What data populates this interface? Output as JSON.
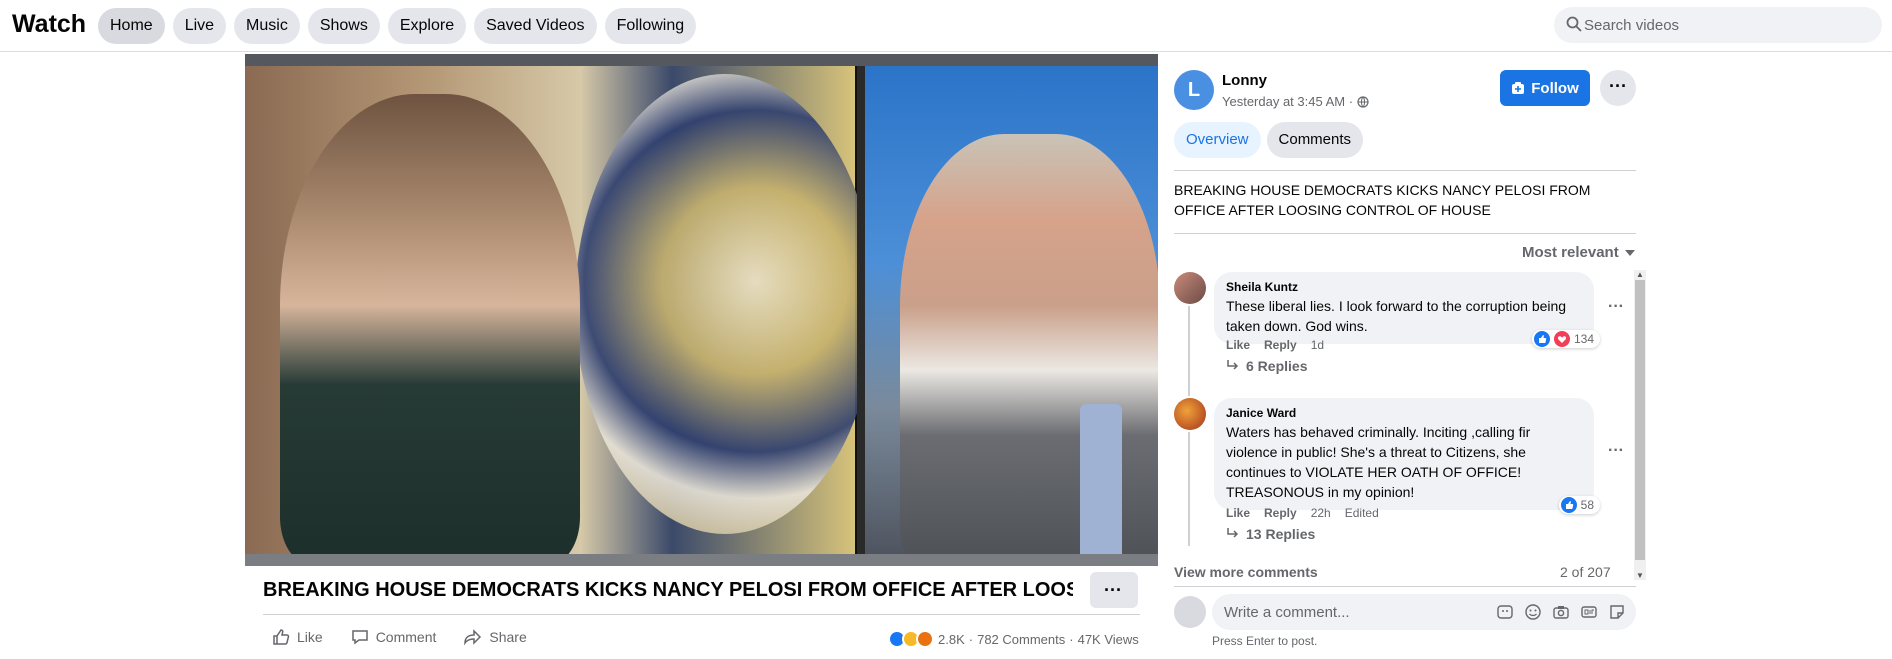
{
  "app": {
    "title": "Watch"
  },
  "nav": {
    "items": [
      "Home",
      "Live",
      "Music",
      "Shows",
      "Explore",
      "Saved Videos",
      "Following"
    ],
    "active": "Home"
  },
  "search": {
    "placeholder": "Search videos"
  },
  "video": {
    "title": "BREAKING HOUSE DEMOCRATS KICKS NANCY PELOSI FROM OFFICE AFTER LOOSIN...",
    "actions": {
      "like": "Like",
      "comment": "Comment",
      "share": "Share"
    },
    "stats": {
      "reactions": "2.8K",
      "comments": "782 Comments",
      "views": "47K Views",
      "separator": "·"
    },
    "reaction_colors": [
      "#1877f2",
      "#f7b928",
      "#e9710f"
    ]
  },
  "post": {
    "avatar_letter": "L",
    "author": "Lonny",
    "time": "Yesterday at 3:45 AM ·",
    "follow_label": "Follow",
    "more_label": "···",
    "tabs": [
      "Overview",
      "Comments"
    ],
    "description": "BREAKING HOUSE DEMOCRATS KICKS NANCY PELOSI FROM OFFICE AFTER LOOSING CONTROL OF HOUSE",
    "sort_label": "Most relevant"
  },
  "comments": [
    {
      "name": "Sheila Kuntz",
      "text": "These liberal lies. I look forward to the corruption being taken down. God wins.",
      "like": "Like",
      "reply": "Reply",
      "time": "1d",
      "edited": "",
      "reaction_count": "134",
      "replies": "6 Replies"
    },
    {
      "name": "Janice Ward",
      "text": "Waters has behaved criminally. Inciting ,calling fir violence in public! She's a threat to Citizens, she continues to VIOLATE HER OATH OF OFFICE! TREASONOUS in my opinion!",
      "like": "Like",
      "reply": "Reply",
      "time": "22h",
      "edited": "Edited",
      "reaction_count": "58",
      "replies": "13 Replies"
    }
  ],
  "footer": {
    "view_more": "View more comments",
    "count": "2 of 207",
    "comment_placeholder": "Write a comment...",
    "enter_hint": "Press Enter to post."
  }
}
